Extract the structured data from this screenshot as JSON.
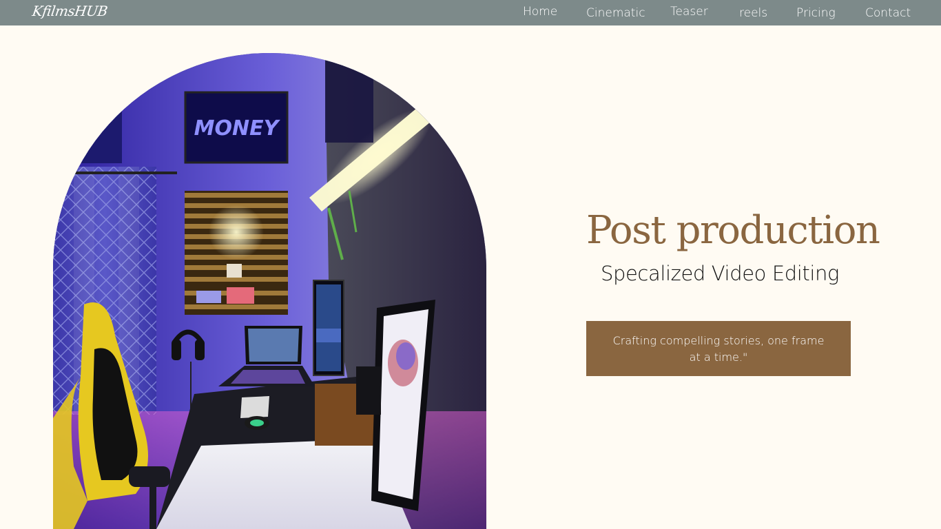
{
  "brand": {
    "logo_text": "KfilmsHUB"
  },
  "nav": {
    "items": [
      {
        "label": "Home"
      },
      {
        "label": "Cinematic"
      },
      {
        "label": "Teaser"
      },
      {
        "label": "reels"
      },
      {
        "label": "Pricing"
      },
      {
        "label": "Contact"
      }
    ]
  },
  "hero": {
    "title": "Post production",
    "subtitle": "Specalized Video Editing",
    "tagline": "Crafting compelling stories, one frame at a time.\""
  },
  "image": {
    "wall_poster_text": "MONEY"
  },
  "colors": {
    "nav_background": "#7d8a8a",
    "page_background": "#fffbf3",
    "accent_brown": "#8a6640"
  }
}
